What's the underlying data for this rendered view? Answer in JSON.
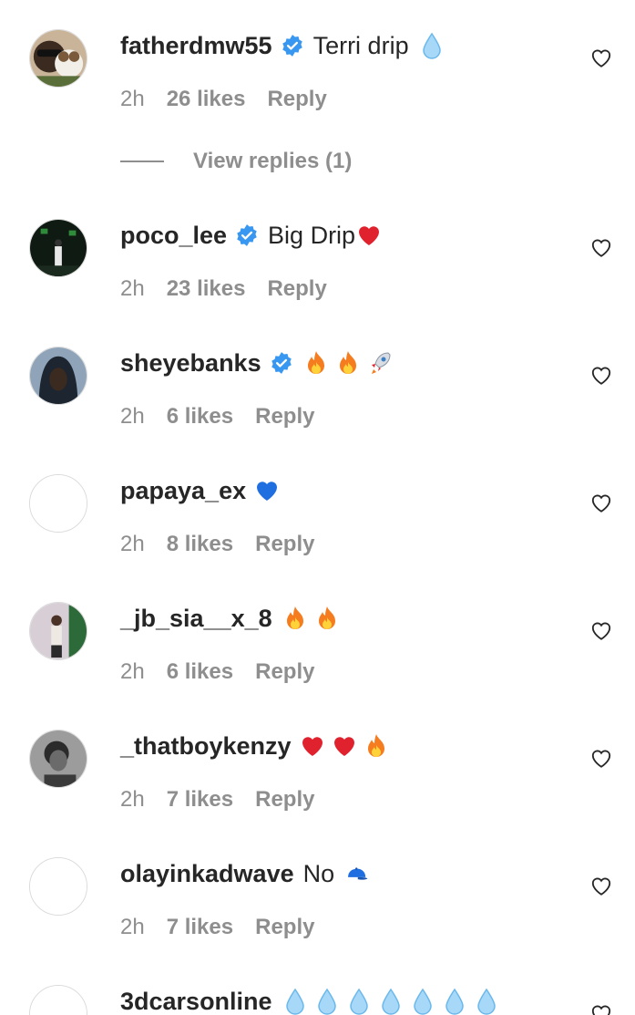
{
  "comments": [
    {
      "username": "fatherdmw55",
      "verified": true,
      "text": "Terri drip",
      "emojis": [
        "droplet"
      ],
      "time": "2h",
      "likes": "26 likes",
      "reply": "Reply"
    },
    {
      "username": "poco_lee",
      "verified": true,
      "text": "Big Drip",
      "emojis": [
        "red-heart"
      ],
      "time": "2h",
      "likes": "23 likes",
      "reply": "Reply"
    },
    {
      "username": "sheyebanks",
      "verified": true,
      "text": "",
      "emojis": [
        "fire",
        "fire",
        "rocket"
      ],
      "time": "2h",
      "likes": "6 likes",
      "reply": "Reply"
    },
    {
      "username": "papaya_ex",
      "verified": false,
      "text": "",
      "emojis": [
        "blue-heart"
      ],
      "time": "2h",
      "likes": "8 likes",
      "reply": "Reply"
    },
    {
      "username": "_jb_sia__x_8",
      "verified": false,
      "text": "",
      "emojis": [
        "fire",
        "fire"
      ],
      "time": "2h",
      "likes": "6 likes",
      "reply": "Reply"
    },
    {
      "username": "_thatboykenzy",
      "verified": false,
      "text": "",
      "emojis": [
        "red-heart",
        "red-heart",
        "fire"
      ],
      "time": "2h",
      "likes": "7 likes",
      "reply": "Reply"
    },
    {
      "username": "olayinkadwave",
      "verified": false,
      "text": "No",
      "emojis": [
        "blue-cap"
      ],
      "time": "2h",
      "likes": "7 likes",
      "reply": "Reply"
    },
    {
      "username": "3dcarsonline",
      "verified": false,
      "text": "",
      "emojis": [
        "droplet",
        "droplet",
        "droplet",
        "droplet",
        "droplet",
        "droplet",
        "droplet"
      ],
      "time": "",
      "likes": "",
      "reply": ""
    }
  ],
  "view_replies": "View replies (1)",
  "colors": {
    "text": "#262626",
    "secondary": "#8e8e8e",
    "verified": "#3897f0",
    "border": "#dbdbdb"
  }
}
